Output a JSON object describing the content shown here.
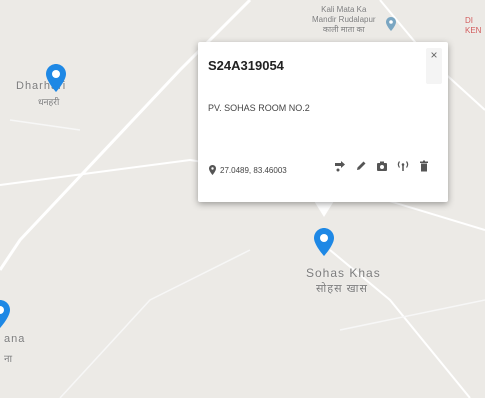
{
  "map": {
    "places": [
      {
        "name": "Kali Mata Ka",
        "line2": "Mandir Rudalapur",
        "line3": "काली माता का"
      },
      {
        "name": "Dharhari",
        "local": "धनहरी"
      },
      {
        "name": "Sohas Khas",
        "local": "सोहस खास"
      },
      {
        "name": "ana",
        "local": "ना"
      },
      {
        "name": "DI",
        "line2": "KEN"
      }
    ]
  },
  "popup": {
    "title": "S24A319054",
    "description": "PV. SOHAS ROOM NO.2",
    "coordinates": "27.0489, 83.46003",
    "close_symbol": "×",
    "tools": [
      "route-icon",
      "edit-icon",
      "camera-icon",
      "signal-tower-icon",
      "delete-icon"
    ]
  },
  "colors": {
    "pin": "#1e88e5",
    "map_bg": "#eceae6",
    "road": "#ffffff"
  }
}
